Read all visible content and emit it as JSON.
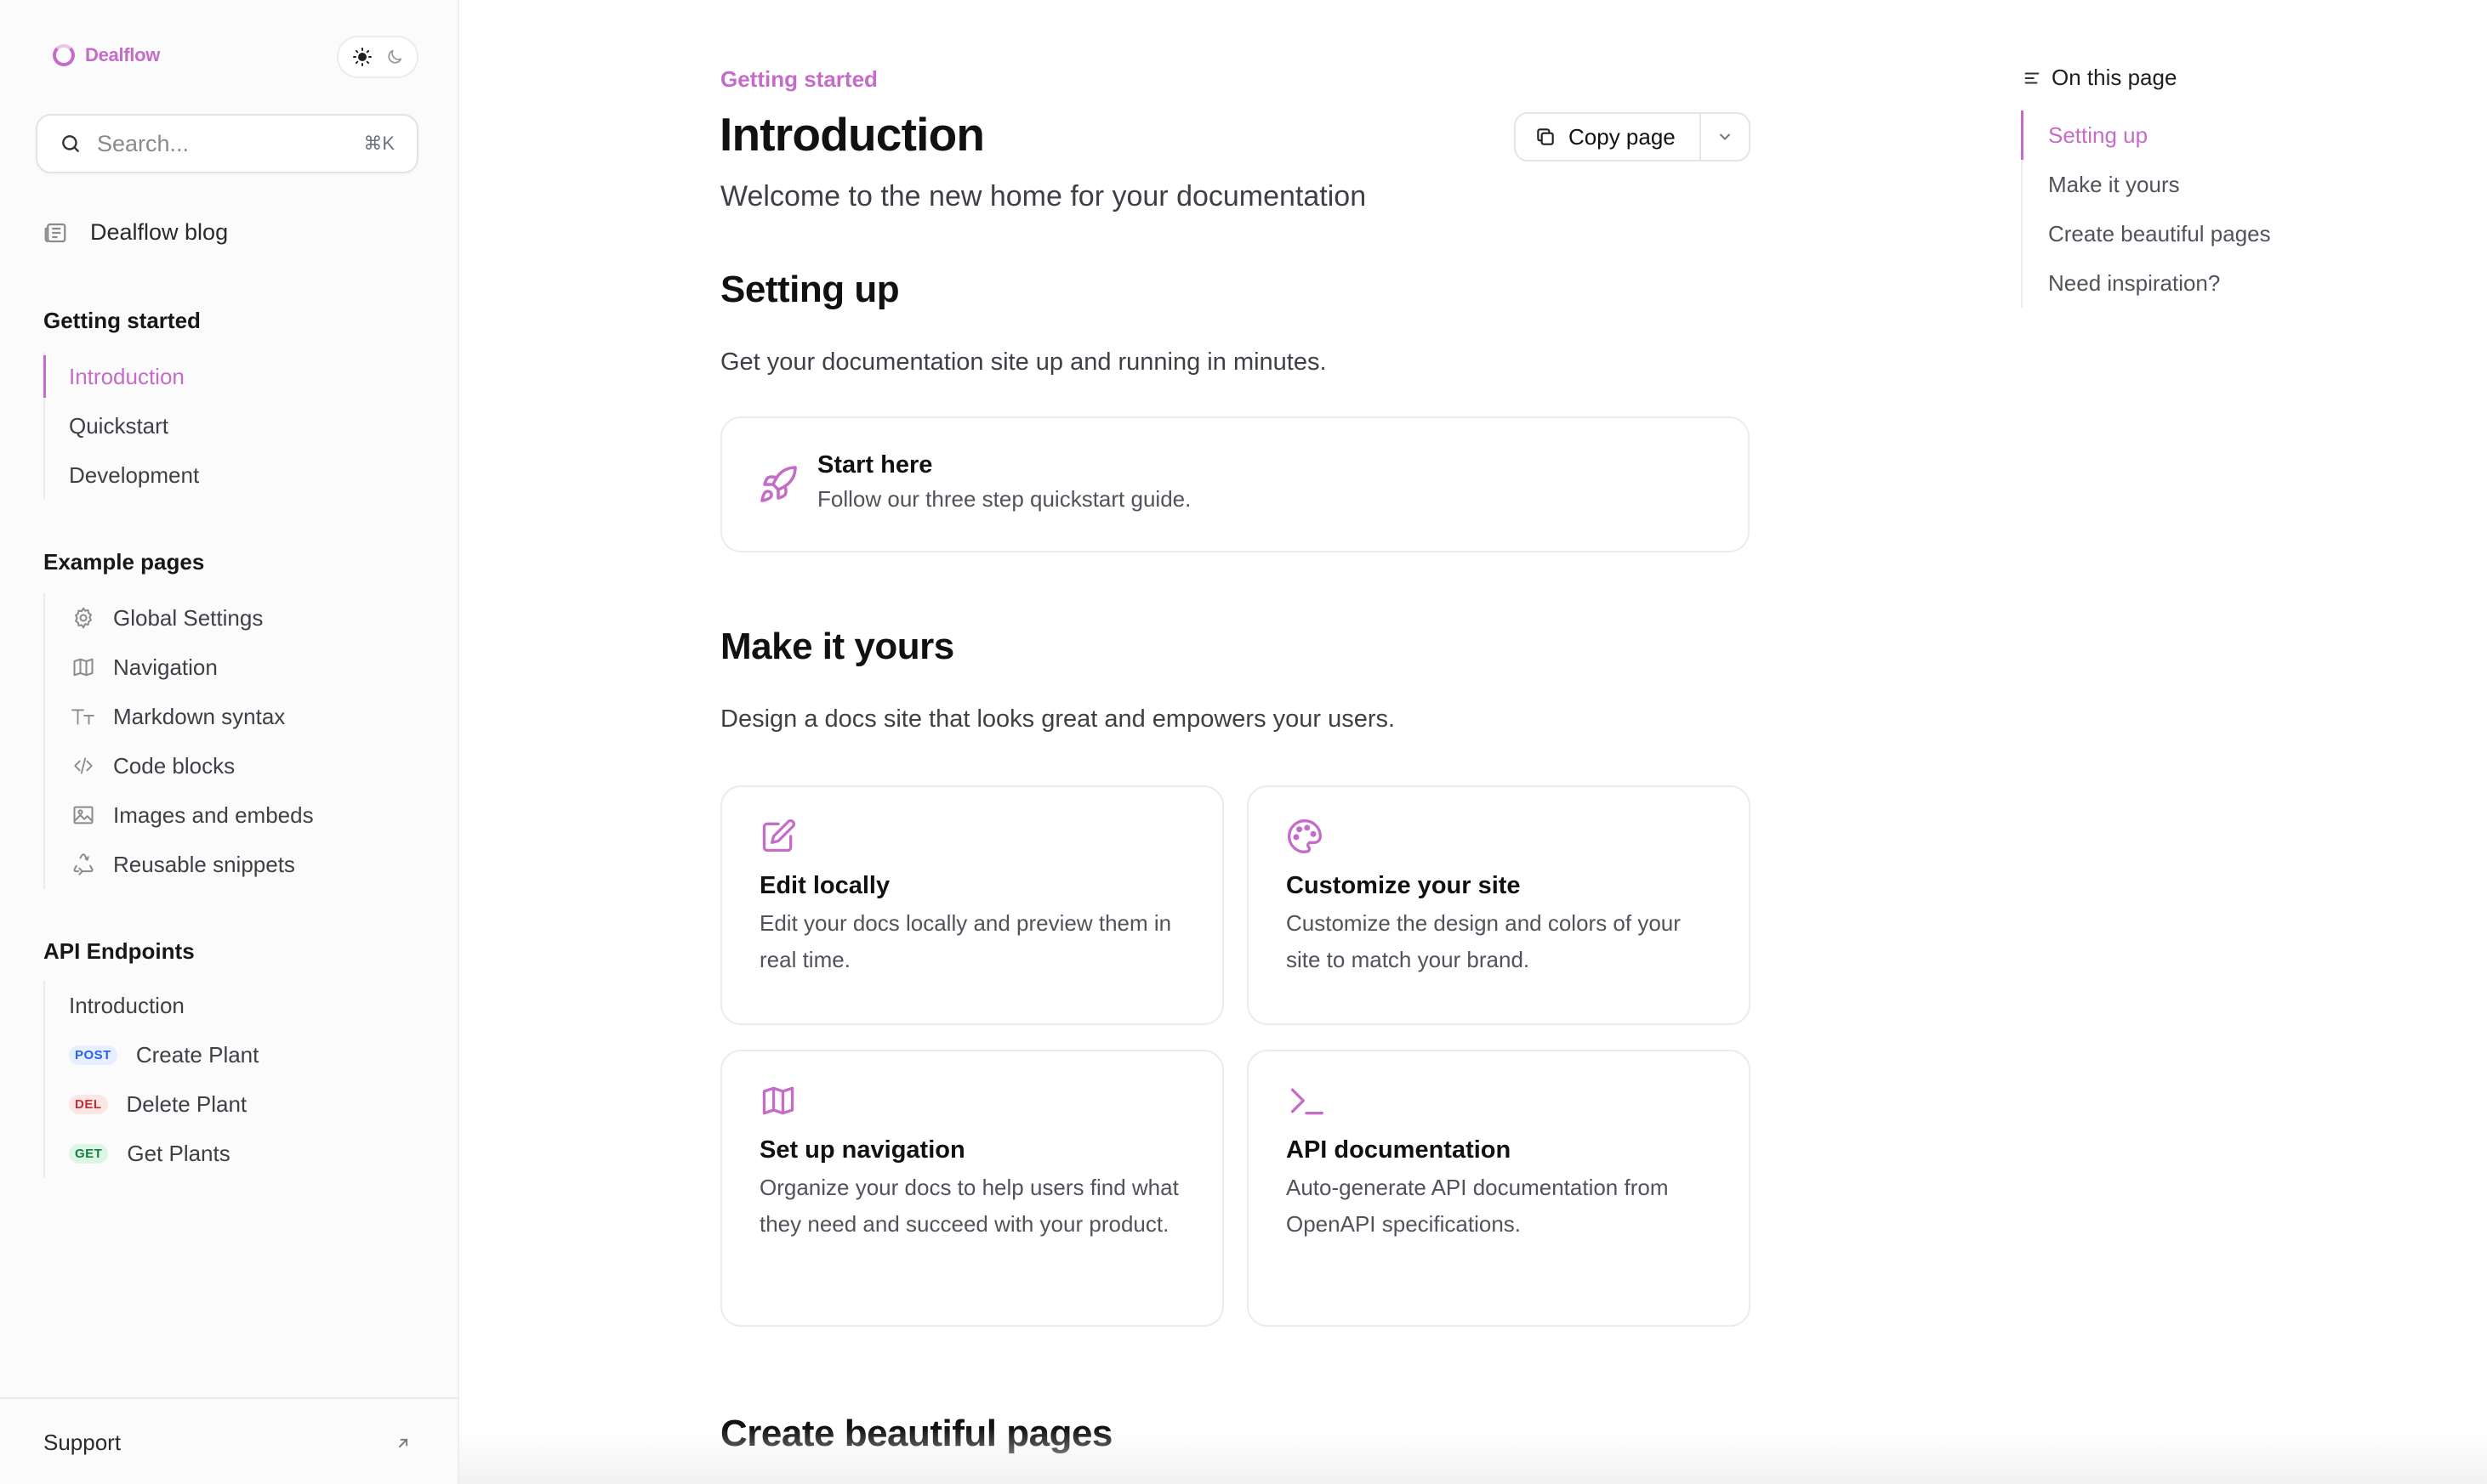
{
  "colors": {
    "accent": "#c56cc9",
    "text": "#111111",
    "muted": "#3f3f46"
  },
  "sidebar": {
    "logo_text": "Dealflow",
    "theme_toggle": {
      "light_icon": "sun-icon",
      "dark_icon": "moon-icon"
    },
    "search": {
      "placeholder": "Search...",
      "shortcut": "⌘K"
    },
    "top_link": {
      "label": "Dealflow blog",
      "icon": "newspaper-icon"
    },
    "groups": [
      {
        "title": "Getting started",
        "items": [
          {
            "label": "Introduction",
            "active": true
          },
          {
            "label": "Quickstart"
          },
          {
            "label": "Development"
          }
        ]
      },
      {
        "title": "Example pages",
        "items": [
          {
            "label": "Global Settings",
            "icon": "gear-icon"
          },
          {
            "label": "Navigation",
            "icon": "map-icon"
          },
          {
            "label": "Markdown syntax",
            "icon": "text-size-icon"
          },
          {
            "label": "Code blocks",
            "icon": "code-icon"
          },
          {
            "label": "Images and embeds",
            "icon": "image-icon"
          },
          {
            "label": "Reusable snippets",
            "icon": "recycle-icon"
          }
        ]
      },
      {
        "title": "API Endpoints",
        "items": [
          {
            "label": "Introduction"
          },
          {
            "label": "Create Plant",
            "method": "POST"
          },
          {
            "label": "Delete Plant",
            "method": "DEL"
          },
          {
            "label": "Get Plants",
            "method": "GET"
          }
        ]
      }
    ],
    "support": {
      "label": "Support",
      "icon": "external-arrow-icon"
    }
  },
  "main": {
    "eyebrow": "Getting started",
    "title": "Introduction",
    "copy_button": "Copy page",
    "subtitle": "Welcome to the new home for your documentation",
    "sections": [
      {
        "heading": "Setting up",
        "text": "Get your documentation site up and running in minutes."
      },
      {
        "heading": "Make it yours",
        "text": "Design a docs site that looks great and empowers your users."
      },
      {
        "heading": "Create beautiful pages"
      }
    ],
    "start_card": {
      "icon": "rocket-icon",
      "title": "Start here",
      "desc": "Follow our three step quickstart guide."
    },
    "cards": [
      {
        "icon": "pencil-icon",
        "title": "Edit locally",
        "desc": "Edit your docs locally and preview them in real time."
      },
      {
        "icon": "palette-icon",
        "title": "Customize your site",
        "desc": "Customize the design and colors of your site to match your brand."
      },
      {
        "icon": "map-icon",
        "title": "Set up navigation",
        "desc": "Organize your docs to help users find what they need and succeed with your product."
      },
      {
        "icon": "terminal-icon",
        "title": "API documentation",
        "desc": "Auto-generate API documentation from OpenAPI specifications."
      }
    ]
  },
  "toc": {
    "heading": "On this page",
    "items": [
      "Setting up",
      "Make it yours",
      "Create beautiful pages",
      "Need inspiration?"
    ],
    "active_index": 0
  }
}
